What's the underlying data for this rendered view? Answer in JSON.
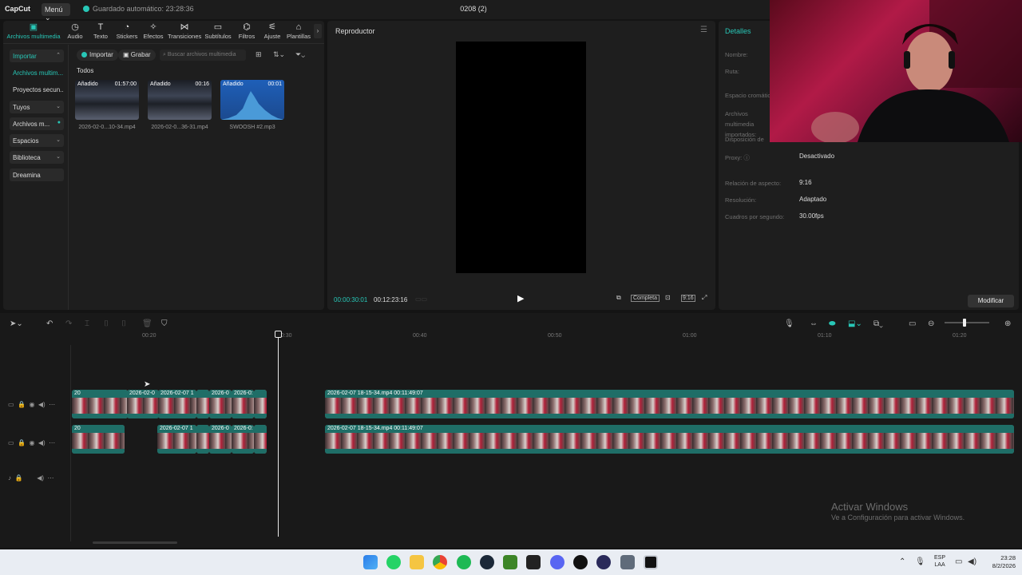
{
  "titlebar": {
    "logo": "CapCut",
    "menu": "Menú",
    "autosave": "Guardado automático: 23:28:36",
    "project_title": "0208 (2)"
  },
  "tool_tabs": [
    {
      "label": "Archivos multimedia",
      "icon": "media-icon",
      "active": true
    },
    {
      "label": "Audio",
      "icon": "audio-icon"
    },
    {
      "label": "Texto",
      "icon": "text-icon"
    },
    {
      "label": "Stickers",
      "icon": "sticker-icon"
    },
    {
      "label": "Efectos",
      "icon": "effects-icon"
    },
    {
      "label": "Transiciones",
      "icon": "transition-icon"
    },
    {
      "label": "Subtítulos",
      "icon": "subtitle-icon"
    },
    {
      "label": "Filtros",
      "icon": "filter-icon"
    },
    {
      "label": "Ajuste",
      "icon": "adjust-icon"
    },
    {
      "label": "Plantillas",
      "icon": "template-icon"
    }
  ],
  "sidebar": {
    "items": [
      {
        "label": "Importar"
      },
      {
        "label": "Archivos multim..."
      },
      {
        "label": "Proyectos secun..."
      },
      {
        "label": "Tuyos"
      },
      {
        "label": "Archivos m..."
      },
      {
        "label": "Espacios"
      },
      {
        "label": "Biblioteca"
      },
      {
        "label": "Dreamina"
      }
    ]
  },
  "media": {
    "import_label": "Importar",
    "record_label": "Grabar",
    "search_placeholder": "Buscar archivos multimedia",
    "section_label": "Todos",
    "items": [
      {
        "tag": "Añadido",
        "duration": "01:57:00",
        "name": "2026-02-0...10-34.mp4"
      },
      {
        "tag": "Añadido",
        "duration": "00:16",
        "name": "2026-02-0...36-31.mp4"
      },
      {
        "tag": "Añadido",
        "duration": "00:01",
        "name": "SWOOSH #2.mp3"
      }
    ]
  },
  "player": {
    "title": "Reproductor",
    "current_time": "00:00:30:01",
    "total_time": "00:12:23:16",
    "fit_label": "Completa",
    "ratio_label": "9:16"
  },
  "details": {
    "title": "Detalles",
    "rows": [
      {
        "label": "Nombre:",
        "value": ""
      },
      {
        "label": "Ruta:",
        "value": ""
      },
      {
        "label": "Espacio cromático:",
        "value": ""
      },
      {
        "label": "Archivos multimedia importados:",
        "value": ""
      },
      {
        "label": "Disposición de",
        "value": ""
      },
      {
        "label": "Proxy:",
        "value": "Desactivado"
      },
      {
        "label": "Relación de aspecto:",
        "value": "9:16"
      },
      {
        "label": "Resolución:",
        "value": "Adaptado"
      },
      {
        "label": "Cuadros por segundo:",
        "value": "30.00fps"
      }
    ],
    "modify_label": "Modificar"
  },
  "timeline": {
    "ruler_labels": [
      "00:20",
      "00:30",
      "00:40",
      "00:50",
      "01:00",
      "01:10",
      "01:20"
    ],
    "clip_main": "2026-02-07 18-15-34.mp4  00:11:49:07",
    "clip_short_a": "2026-02-0",
    "clip_short_b": "2026-02-07 1",
    "clip_short_c": "2026-0",
    "clip_short_d": "2026-0:",
    "clip_tiny": "20"
  },
  "watermark": {
    "line1": "Activar Windows",
    "line2": "Ve a Configuración para activar Windows."
  },
  "taskbar": {
    "lang1": "ESP",
    "lang2": "LAA",
    "time": "23:28",
    "date": "8/2/2026"
  },
  "colors": {
    "accent": "#28c7b7",
    "background": "#141414",
    "panel": "#1e1e1e",
    "clip_header": "#1f6e67"
  }
}
